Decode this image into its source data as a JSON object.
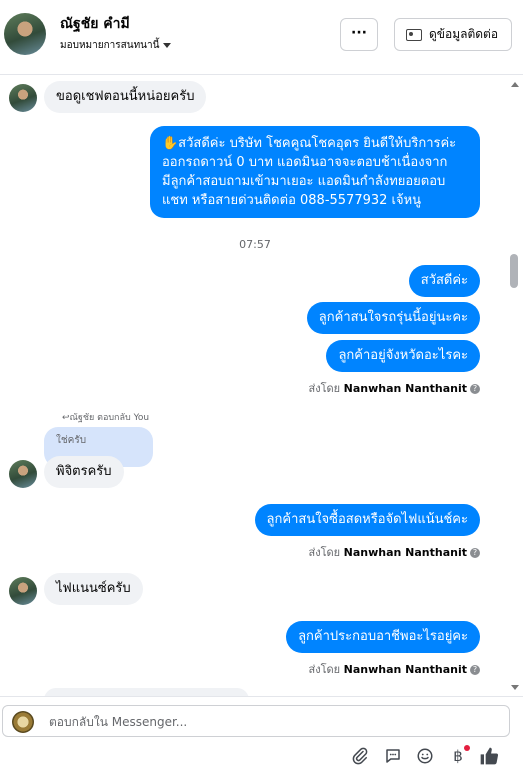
{
  "header": {
    "contact_name": "ณัฐชัย คำมี",
    "assign_label": "มอบหมายการสนทนานี้",
    "more_label": "···",
    "contact_info_label": "ดูข้อมูลติดต่อ"
  },
  "messages": {
    "m1": "ขอดูเชฟตอนนี้หน่อยครับ",
    "m2_line1": "✋สวัสดีค่ะ บริษัท โชคคูณโชคอุดร ยินดีให้บริการค่ะ",
    "m2_line2": "ออกรถดาวน์ 0 บาท แอดมินอาจจะตอบช้าเนื่องจาก",
    "m2_line3": "มีลูกค้าสอบถามเข้ามาเยอะ แอดมินกำลังทยอยตอบ",
    "m2_line4": "แชท หรือสายด่วนติดต่อ 088-5577932 เจ้หนู",
    "time": "07:57",
    "m3": "สวัสดีค่ะ",
    "m4": "ลูกค้าสนใจรถรุ่นนี้อยู่นะคะ",
    "m5": "ลูกค้าอยู่จังหวัดอะไรคะ",
    "sent_prefix": "ส่งโดย",
    "sender": "Nanwhan Nanthanit",
    "reply_label": "↩ณัฐชัย ตอบกลับ You",
    "quoted": "ใช่ครับ",
    "m6": "พิจิตรครับ",
    "m7": "ลูกค้าสนใจซื้อสดหรือจัดไฟแน้นช์คะ",
    "m8": "ไฟแนนซ์ครับ",
    "m9": "ลูกค้าประกอบอาชีพอะไรอยู่คะ"
  },
  "composer": {
    "placeholder": "ตอบกลับใน Messenger..."
  },
  "icons": {
    "attach": "paperclip-icon",
    "saved_reply": "chat-bubble-icon",
    "emoji": "smile-icon",
    "currency": "baht-icon",
    "like": "thumbs-up-icon"
  },
  "colors": {
    "outgoing": "#0084ff",
    "incoming": "#f0f2f5",
    "quote": "#d6e4fb"
  }
}
